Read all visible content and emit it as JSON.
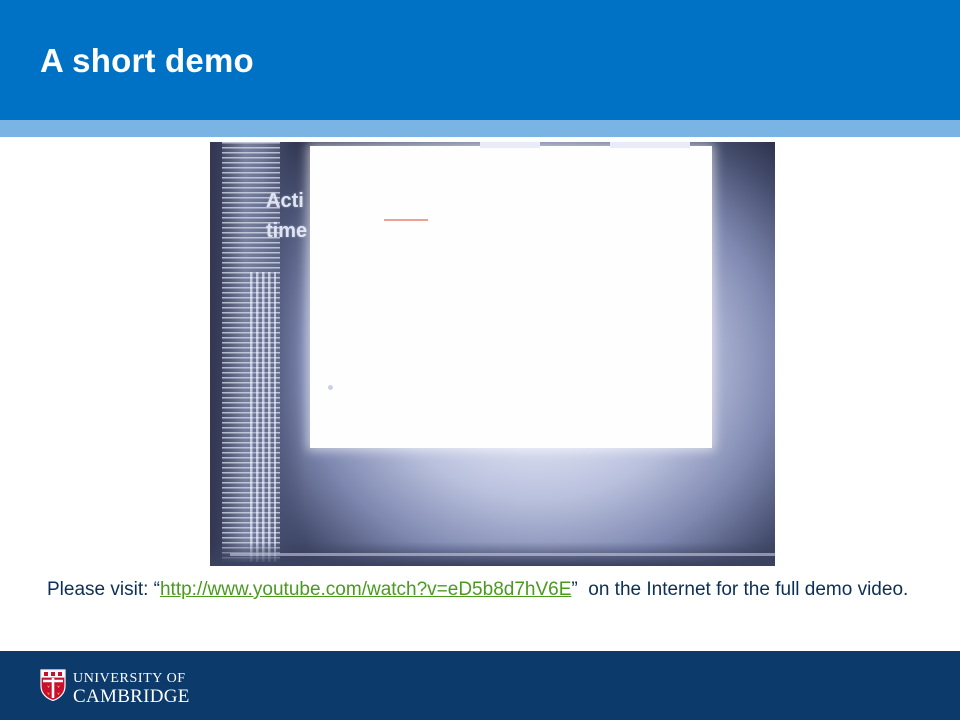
{
  "slide": {
    "title": "A short demo",
    "colors": {
      "header": "#0072c6",
      "header_stripe": "#79b4e4",
      "footer": "#0c3a6b",
      "link": "#4a9a1e",
      "caption_text": "#0b2f55"
    }
  },
  "video": {
    "overlay_text": "Acti\ntime"
  },
  "caption": {
    "prefix": "Please visit: “",
    "link_text": "http://www.youtube.com/watch?v=eD5b8d7hV6E",
    "after_link": "”  on the Internet for the full demo video."
  },
  "footer": {
    "logo_icon": "cambridge-crest-icon",
    "university_line1": "UNIVERSITY OF",
    "university_line2": "CAMBRIDGE"
  }
}
